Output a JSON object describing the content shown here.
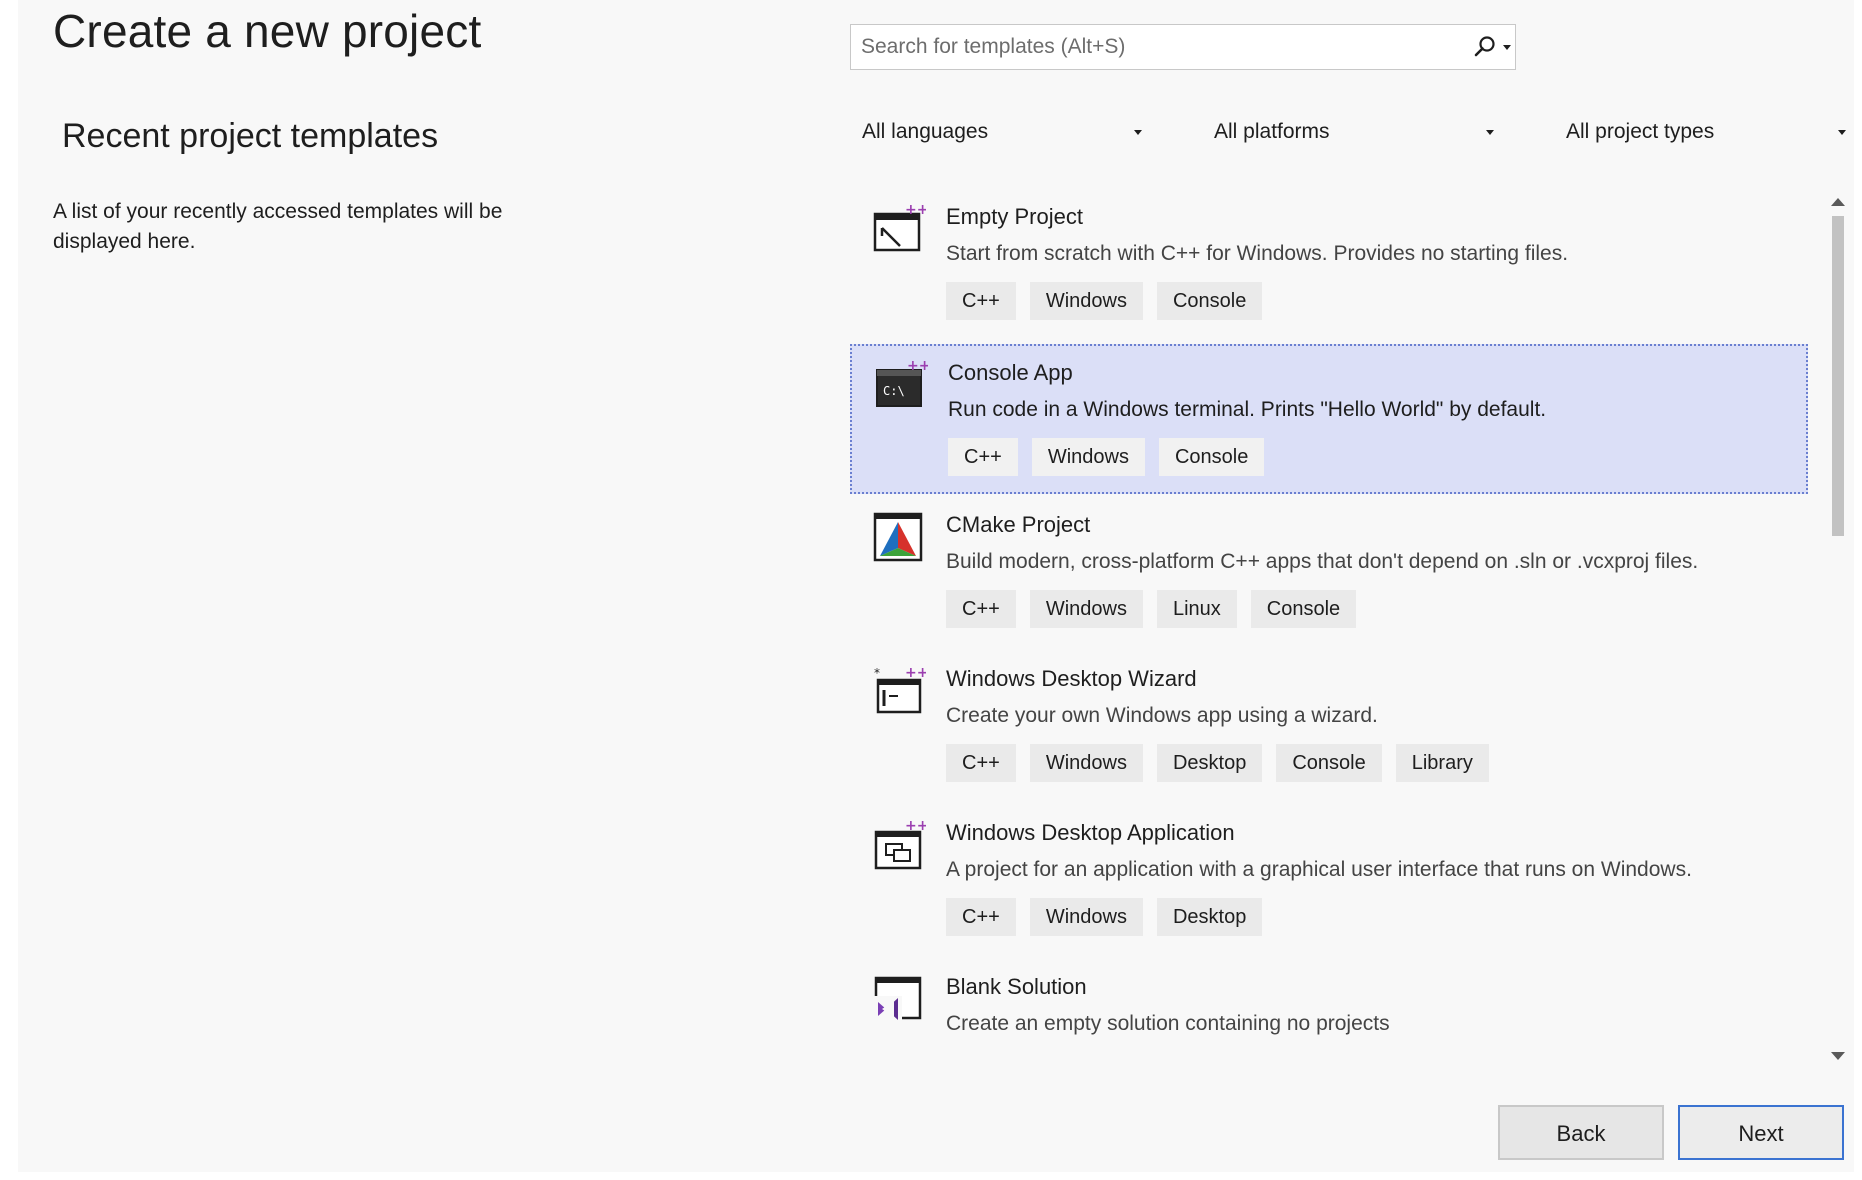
{
  "page": {
    "title": "Create a new project"
  },
  "recent": {
    "title": "Recent project templates",
    "description": "A list of your recently accessed templates will be displayed here."
  },
  "search": {
    "placeholder": "Search for templates (Alt+S)",
    "value": ""
  },
  "filters": {
    "languages": "All languages",
    "platforms": "All platforms",
    "project_types": "All project types"
  },
  "templates": [
    {
      "name": "Empty Project",
      "description": "Start from scratch with C++ for Windows. Provides no starting files.",
      "icon": "empty-project-icon",
      "tags": [
        "C++",
        "Windows",
        "Console"
      ],
      "selected": false
    },
    {
      "name": "Console App",
      "description": "Run code in a Windows terminal. Prints \"Hello World\" by default.",
      "icon": "console-app-icon",
      "tags": [
        "C++",
        "Windows",
        "Console"
      ],
      "selected": true
    },
    {
      "name": "CMake Project",
      "description": "Build modern, cross-platform C++ apps that don't depend on .sln or .vcxproj files.",
      "icon": "cmake-icon",
      "tags": [
        "C++",
        "Windows",
        "Linux",
        "Console"
      ],
      "selected": false
    },
    {
      "name": "Windows Desktop Wizard",
      "description": "Create your own Windows app using a wizard.",
      "icon": "desktop-wizard-icon",
      "tags": [
        "C++",
        "Windows",
        "Desktop",
        "Console",
        "Library"
      ],
      "selected": false
    },
    {
      "name": "Windows Desktop Application",
      "description": "A project for an application with a graphical user interface that runs on Windows.",
      "icon": "desktop-application-icon",
      "tags": [
        "C++",
        "Windows",
        "Desktop"
      ],
      "selected": false
    },
    {
      "name": "Blank Solution",
      "description": "Create an empty solution containing no projects",
      "icon": "visual-studio-solution-icon",
      "tags": [],
      "selected": false
    }
  ],
  "buttons": {
    "back": "Back",
    "next": "Next"
  },
  "colors": {
    "selected_background": "#dbdff7",
    "selected_border": "#6a7fd0",
    "tag_background": "#eaeaea",
    "primary_button_border": "#3b73d1"
  }
}
